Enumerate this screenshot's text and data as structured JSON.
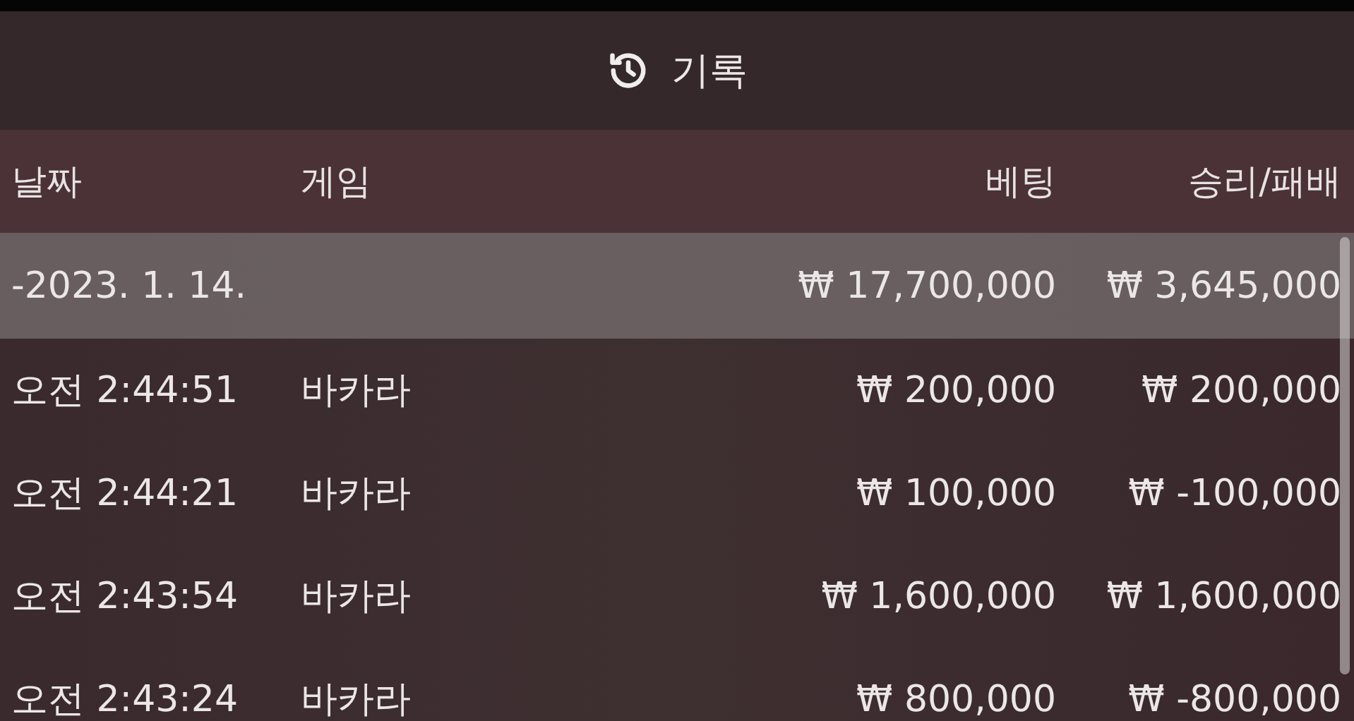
{
  "header": {
    "title": "기록"
  },
  "table": {
    "columns": [
      "날짜",
      "게임",
      "베팅",
      "승리/패배"
    ],
    "rows": [
      {
        "kind": "group",
        "date": "-2023. 1. 14.",
        "game": "",
        "bet": "₩ 17,700,000",
        "result": "₩ 3,645,000"
      },
      {
        "kind": "entry",
        "date": "오전 2:44:51",
        "game": "바카라",
        "bet": "₩ 200,000",
        "result": "₩ 200,000"
      },
      {
        "kind": "entry",
        "date": "오전 2:44:21",
        "game": "바카라",
        "bet": "₩ 100,000",
        "result": "₩ -100,000"
      },
      {
        "kind": "entry",
        "date": "오전 2:43:54",
        "game": "바카라",
        "bet": "₩ 1,600,000",
        "result": "₩ 1,600,000"
      },
      {
        "kind": "entry",
        "date": "오전 2:43:24",
        "game": "바카라",
        "bet": "₩ 800,000",
        "result": "₩ -800,000"
      }
    ]
  }
}
